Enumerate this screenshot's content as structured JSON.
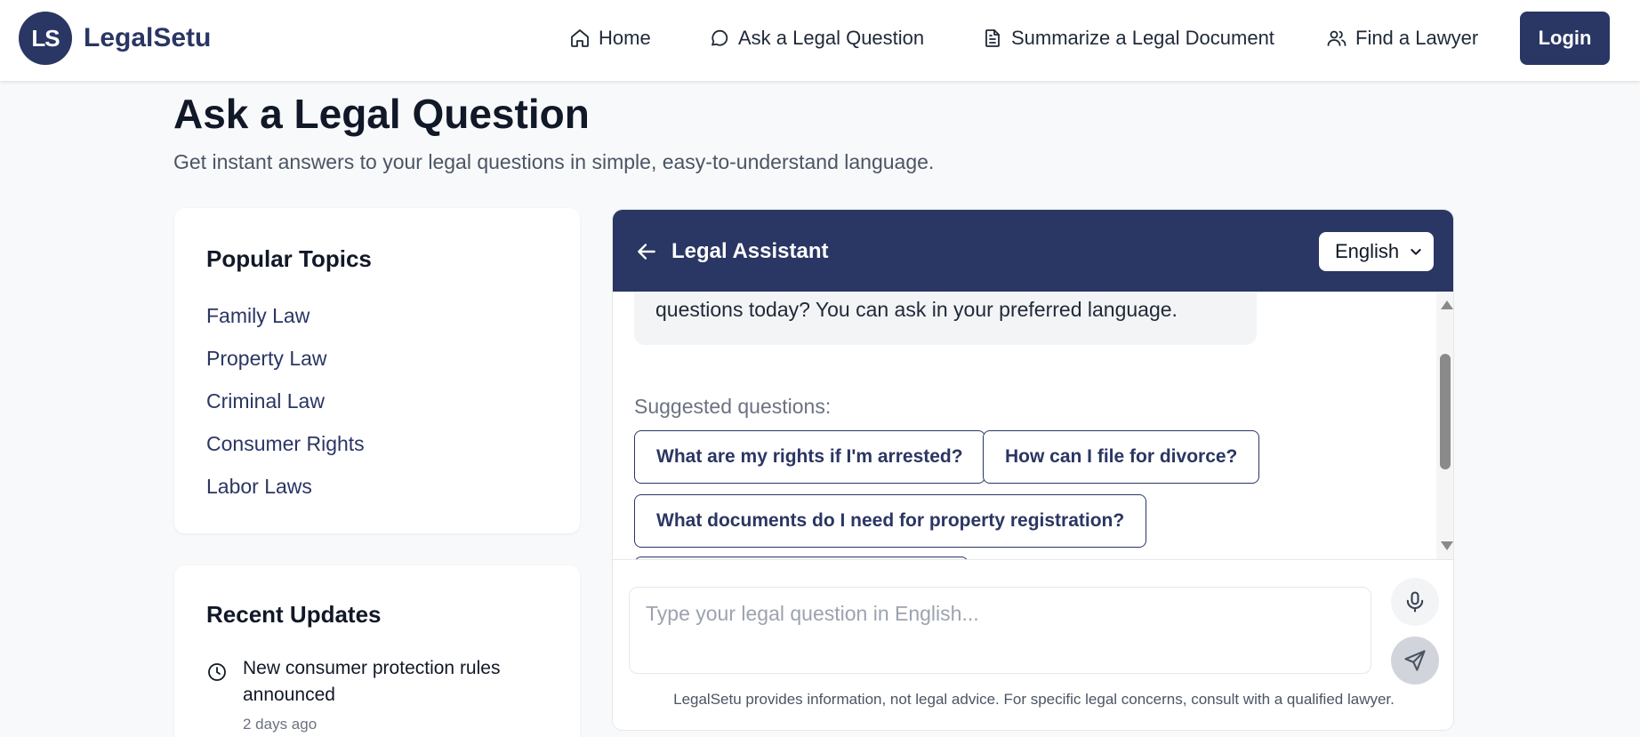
{
  "header": {
    "logo_initials": "LS",
    "brand": "LegalSetu",
    "nav": [
      {
        "label": "Home",
        "icon": "home-icon"
      },
      {
        "label": "Ask a Legal Question",
        "icon": "chat-bubble-icon"
      },
      {
        "label": "Summarize a Legal Document",
        "icon": "document-icon"
      },
      {
        "label": "Find a Lawyer",
        "icon": "users-icon"
      }
    ],
    "login_label": "Login"
  },
  "page": {
    "title": "Ask a Legal Question",
    "subtitle": "Get instant answers to your legal questions in simple, easy-to-understand language."
  },
  "popular_topics": {
    "title": "Popular Topics",
    "items": [
      "Family Law",
      "Property Law",
      "Criminal Law",
      "Consumer Rights",
      "Labor Laws"
    ]
  },
  "recent_updates": {
    "title": "Recent Updates",
    "items": [
      {
        "text": "New consumer protection rules announced",
        "time": "2 days ago"
      }
    ]
  },
  "chat": {
    "title": "Legal Assistant",
    "language": "English",
    "assistant_message_visible": "questions today? You can ask in your preferred language.",
    "suggested_label": "Suggested questions:",
    "suggestions": [
      "What are my rights if I'm arrested?",
      "How can I file for divorce?",
      "What documents do I need for property registration?"
    ],
    "input_placeholder": "Type your legal question in English...",
    "disclaimer": "LegalSetu provides information, not legal advice. For specific legal concerns, consult with a qualified lawyer."
  },
  "colors": {
    "brand": "#2a3663",
    "background": "#f8f9fb",
    "bubble": "#f3f4f6"
  }
}
